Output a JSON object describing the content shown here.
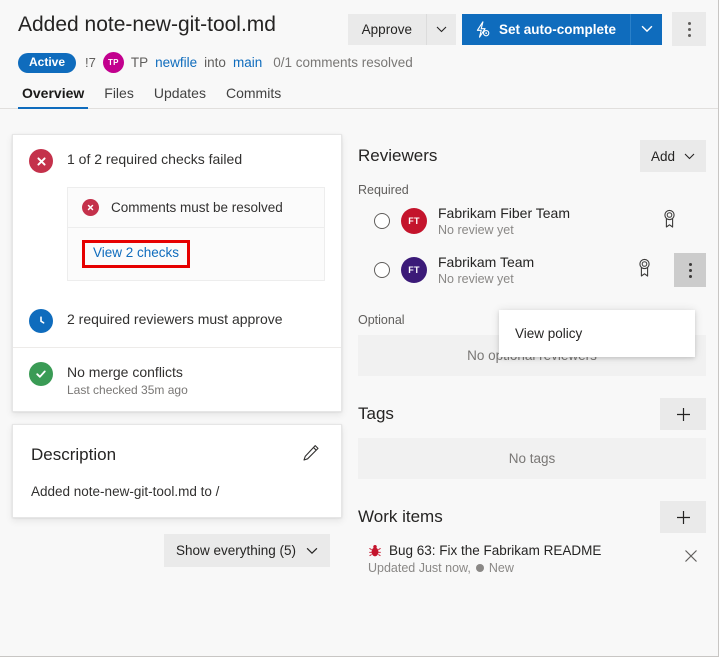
{
  "header": {
    "title": "Added note-new-git-tool.md",
    "approve_label": "Approve",
    "approve_caret_icon": "chevron-down-icon",
    "autocomplete_label": "Set auto-complete",
    "autocomplete_icon": "lightning-gear-icon",
    "autocomplete_caret_icon": "chevron-down-icon",
    "more_icon": "kebab-menu-icon"
  },
  "meta": {
    "status_badge": "Active",
    "pr_number": "!7",
    "avatar_initials": "TP",
    "avatar_color": "#c2008e",
    "author": "TP",
    "source_branch": "newfile",
    "into_label": "into",
    "target_branch": "main",
    "comments_resolved": "0/1 comments resolved"
  },
  "tabs": [
    {
      "label": "Overview",
      "active": true
    },
    {
      "label": "Files",
      "active": false
    },
    {
      "label": "Updates",
      "active": false
    },
    {
      "label": "Commits",
      "active": false
    }
  ],
  "checks": {
    "failed_summary": "1 of 2 required checks failed",
    "failed_icon": "error-circle-icon",
    "sub_check_label": "Comments must be resolved",
    "sub_check_icon": "error-circle-icon",
    "view_checks_link": "View 2 checks",
    "highlight_color": "#e60000",
    "reviewers_pending": "2 required reviewers must approve",
    "reviewers_pending_icon": "clock-icon",
    "merge_conflicts": "No merge conflicts",
    "merge_conflicts_sub": "Last checked 35m ago",
    "merge_conflicts_icon": "check-circle-icon"
  },
  "description": {
    "title": "Description",
    "edit_icon": "pencil-icon",
    "body": "Added note-new-git-tool.md to /"
  },
  "show_everything": {
    "label": "Show everything (5)",
    "caret_icon": "chevron-down-icon"
  },
  "reviewers": {
    "title": "Reviewers",
    "add_label": "Add",
    "add_caret_icon": "chevron-down-icon",
    "required_label": "Required",
    "optional_label": "Optional",
    "optional_empty": "No optional reviewers",
    "list": [
      {
        "name": "Fabrikam Fiber Team",
        "status": "No review yet",
        "initials": "FT",
        "color": "#c4142c",
        "policy_icon": "ribbon-badge-icon",
        "kebab_visible": false
      },
      {
        "name": "Fabrikam Team",
        "status": "No review yet",
        "initials": "FT",
        "color": "#3b1a78",
        "policy_icon": "ribbon-badge-icon",
        "kebab_visible": true
      }
    ],
    "context_menu": {
      "items": [
        {
          "label": "View policy"
        }
      ]
    }
  },
  "tags": {
    "title": "Tags",
    "add_icon": "plus-icon",
    "empty": "No tags"
  },
  "work_items": {
    "title": "Work items",
    "add_icon": "plus-icon",
    "items": [
      {
        "icon": "bug-icon",
        "title": "Bug 63: Fix the Fabrikam README",
        "updated": "Updated Just now,",
        "state": "New",
        "remove_icon": "close-icon"
      }
    ]
  },
  "colors": {
    "accent": "#0f6cbd",
    "fail": "#c4314b",
    "success": "#3a9b55",
    "pending": "#0f6cbd",
    "highlight": "#e60000"
  }
}
